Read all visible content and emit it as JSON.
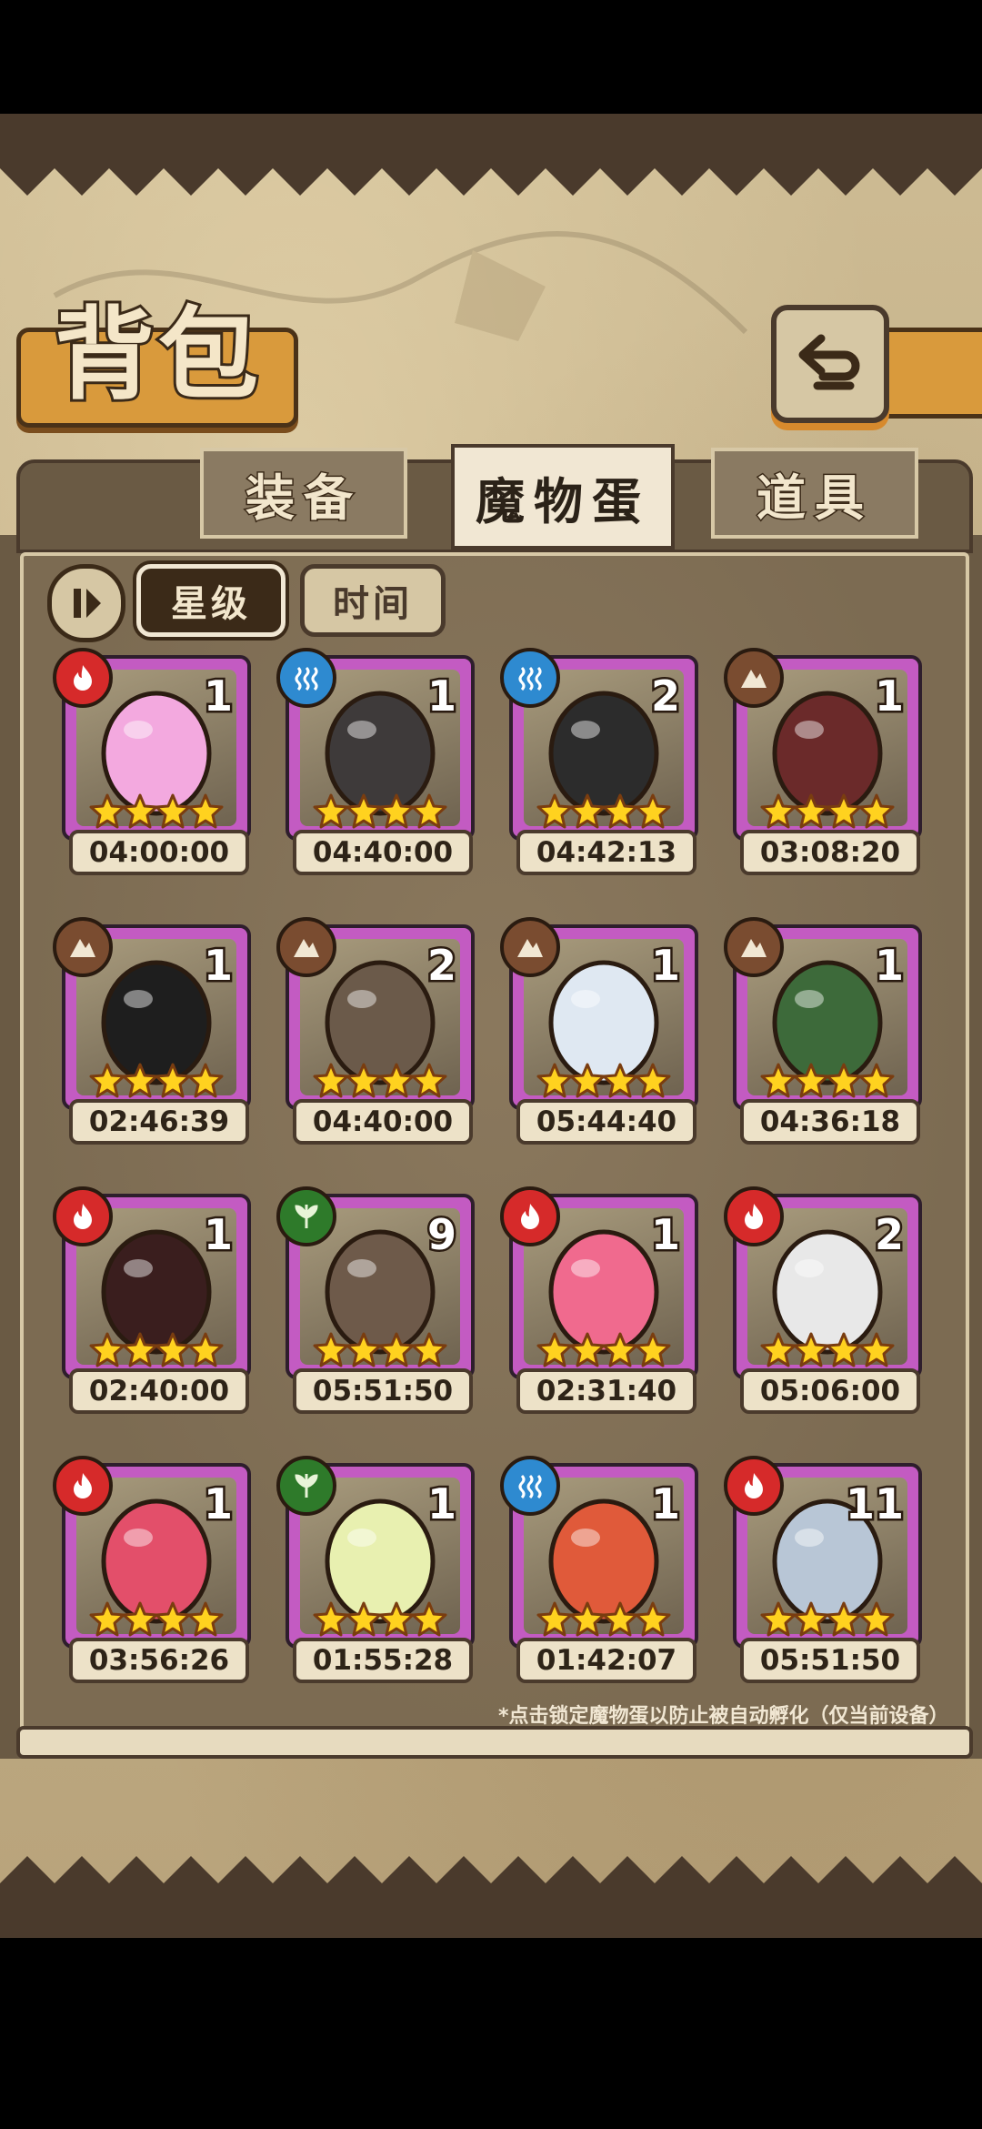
{
  "title": "背包",
  "tabs": [
    {
      "label": "装备"
    },
    {
      "label": "魔物蛋"
    },
    {
      "label": "道具"
    }
  ],
  "sort": {
    "star_label": "星级",
    "time_label": "时间"
  },
  "eggs": [
    {
      "element": "fire",
      "count": "1",
      "timer": "04:00:00",
      "color": "#f3a9df"
    },
    {
      "element": "water",
      "count": "1",
      "timer": "04:40:00",
      "color": "#3e3a3a"
    },
    {
      "element": "water",
      "count": "2",
      "timer": "04:42:13",
      "color": "#2c2c2c"
    },
    {
      "element": "earth",
      "count": "1",
      "timer": "03:08:20",
      "color": "#6b2a2a"
    },
    {
      "element": "earth",
      "count": "1",
      "timer": "02:46:39",
      "color": "#1e1e1e"
    },
    {
      "element": "earth",
      "count": "2",
      "timer": "04:40:00",
      "color": "#6b5a4a"
    },
    {
      "element": "earth",
      "count": "1",
      "timer": "05:44:40",
      "color": "#dfe8f2"
    },
    {
      "element": "earth",
      "count": "1",
      "timer": "04:36:18",
      "color": "#3d6a3a"
    },
    {
      "element": "fire",
      "count": "1",
      "timer": "02:40:00",
      "color": "#3a1e1e"
    },
    {
      "element": "grass",
      "count": "9",
      "timer": "05:51:50",
      "color": "#6e5a4a"
    },
    {
      "element": "fire",
      "count": "1",
      "timer": "02:31:40",
      "color": "#f06a8e"
    },
    {
      "element": "fire",
      "count": "2",
      "timer": "05:06:00",
      "color": "#e8e8e8"
    },
    {
      "element": "fire",
      "count": "1",
      "timer": "03:56:26",
      "color": "#e34f6a"
    },
    {
      "element": "grass",
      "count": "1",
      "timer": "01:55:28",
      "color": "#e8f0b0"
    },
    {
      "element": "water",
      "count": "1",
      "timer": "01:42:07",
      "color": "#e05a3a"
    },
    {
      "element": "fire",
      "count": "11",
      "timer": "05:51:50",
      "color": "#b8c6d6"
    }
  ],
  "footnote": "*点击锁定魔物蛋以防止被自动孵化（仅当前设备）"
}
